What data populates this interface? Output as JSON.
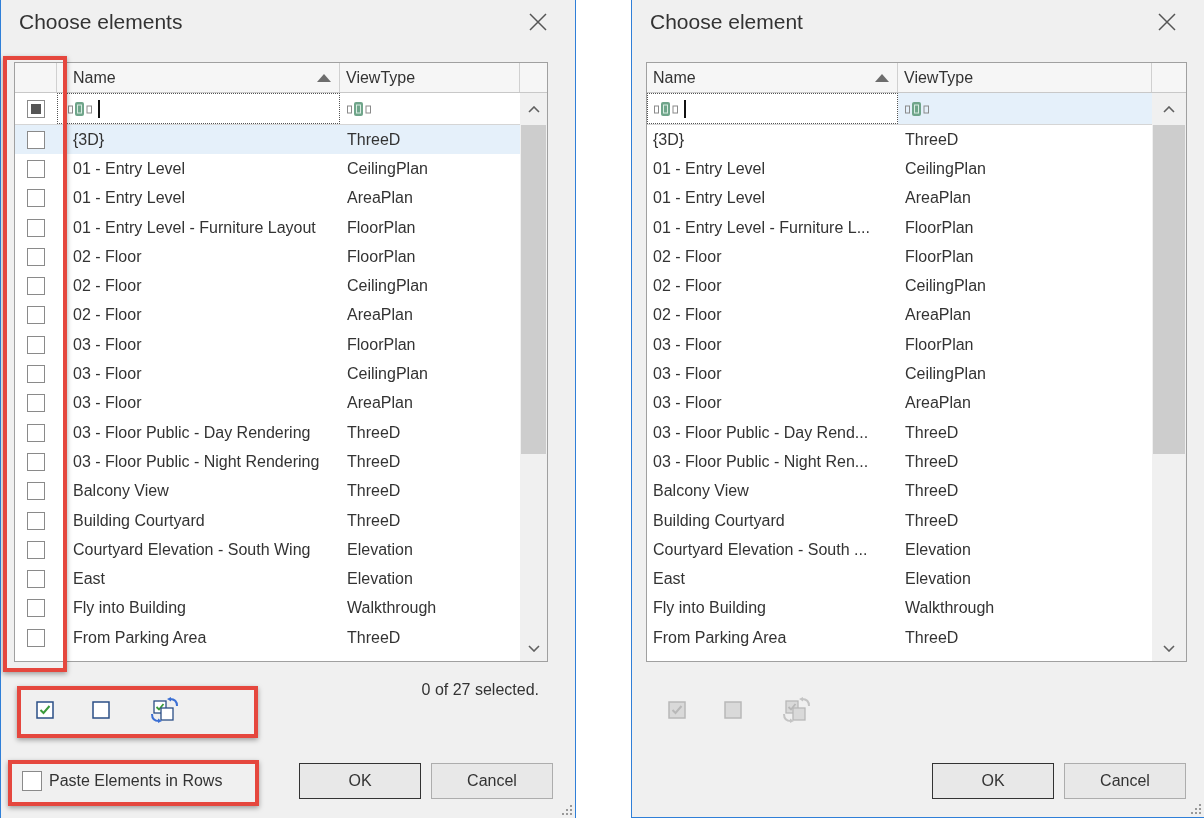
{
  "dialogs": [
    {
      "title": "Choose elements",
      "columns": [
        {
          "label": "Name",
          "sorted": true
        },
        {
          "label": "ViewType",
          "sorted": false
        }
      ],
      "check_column": {
        "select_all": {
          "checked": false,
          "indeterminate": true
        },
        "highlighted": true
      },
      "filters": [
        {
          "focused": true,
          "selected": false
        },
        {
          "focused": false,
          "selected": false
        }
      ],
      "rows": [
        {
          "name": "{3D}",
          "view_type": "ThreeD",
          "selected": true,
          "checked": false
        },
        {
          "name": "01 - Entry Level",
          "view_type": "CeilingPlan",
          "selected": false,
          "checked": false
        },
        {
          "name": "01 - Entry Level",
          "view_type": "AreaPlan",
          "selected": false,
          "checked": false
        },
        {
          "name": "01 - Entry Level - Furniture Layout",
          "view_type": "FloorPlan",
          "selected": false,
          "checked": false
        },
        {
          "name": "02 - Floor",
          "view_type": "FloorPlan",
          "selected": false,
          "checked": false
        },
        {
          "name": "02 - Floor",
          "view_type": "CeilingPlan",
          "selected": false,
          "checked": false
        },
        {
          "name": "02 - Floor",
          "view_type": "AreaPlan",
          "selected": false,
          "checked": false
        },
        {
          "name": "03 - Floor",
          "view_type": "FloorPlan",
          "selected": false,
          "checked": false
        },
        {
          "name": "03 - Floor",
          "view_type": "CeilingPlan",
          "selected": false,
          "checked": false
        },
        {
          "name": "03 - Floor",
          "view_type": "AreaPlan",
          "selected": false,
          "checked": false
        },
        {
          "name": "03 - Floor Public - Day Rendering",
          "view_type": "ThreeD",
          "selected": false,
          "checked": false
        },
        {
          "name": "03 - Floor Public - Night Rendering",
          "view_type": "ThreeD",
          "selected": false,
          "checked": false
        },
        {
          "name": "Balcony View",
          "view_type": "ThreeD",
          "selected": false,
          "checked": false
        },
        {
          "name": "Building Courtyard",
          "view_type": "ThreeD",
          "selected": false,
          "checked": false
        },
        {
          "name": "Courtyard Elevation - South Wing",
          "view_type": "Elevation",
          "selected": false,
          "checked": false
        },
        {
          "name": "East",
          "view_type": "Elevation",
          "selected": false,
          "checked": false
        },
        {
          "name": "Fly into Building",
          "view_type": "Walkthrough",
          "selected": false,
          "checked": false
        },
        {
          "name": "From Parking Area",
          "view_type": "ThreeD",
          "selected": false,
          "checked": false
        }
      ],
      "tools": {
        "disabled": false,
        "highlighted": true,
        "items": [
          {
            "kind": "check-all"
          },
          {
            "kind": "uncheck-all"
          },
          {
            "kind": "invert"
          }
        ]
      },
      "status": "0 of 27 selected.",
      "paste_option": {
        "label": "Paste Elements in Rows",
        "checked": false,
        "highlighted": true
      },
      "buttons": [
        {
          "label": "OK",
          "default": true
        },
        {
          "label": "Cancel",
          "default": false
        }
      ]
    },
    {
      "title": "Choose element",
      "columns": [
        {
          "label": "Name",
          "sorted": true
        },
        {
          "label": "ViewType",
          "sorted": false
        }
      ],
      "filters": [
        {
          "focused": true,
          "selected": false
        },
        {
          "focused": false,
          "selected": true
        }
      ],
      "rows": [
        {
          "name": "{3D}",
          "view_type": "ThreeD",
          "selected": false
        },
        {
          "name": "01 - Entry Level",
          "view_type": "CeilingPlan",
          "selected": false
        },
        {
          "name": "01 - Entry Level",
          "view_type": "AreaPlan",
          "selected": false
        },
        {
          "name": "01 - Entry Level - Furniture L...",
          "view_type": "FloorPlan",
          "selected": false
        },
        {
          "name": "02 - Floor",
          "view_type": "FloorPlan",
          "selected": false
        },
        {
          "name": "02 - Floor",
          "view_type": "CeilingPlan",
          "selected": false
        },
        {
          "name": "02 - Floor",
          "view_type": "AreaPlan",
          "selected": false
        },
        {
          "name": "03 - Floor",
          "view_type": "FloorPlan",
          "selected": false
        },
        {
          "name": "03 - Floor",
          "view_type": "CeilingPlan",
          "selected": false
        },
        {
          "name": "03 - Floor",
          "view_type": "AreaPlan",
          "selected": false
        },
        {
          "name": "03 - Floor Public - Day Rend...",
          "view_type": "ThreeD",
          "selected": false
        },
        {
          "name": "03 - Floor Public - Night Ren...",
          "view_type": "ThreeD",
          "selected": false
        },
        {
          "name": "Balcony View",
          "view_type": "ThreeD",
          "selected": false
        },
        {
          "name": "Building Courtyard",
          "view_type": "ThreeD",
          "selected": false
        },
        {
          "name": "Courtyard Elevation - South ...",
          "view_type": "Elevation",
          "selected": false
        },
        {
          "name": "East",
          "view_type": "Elevation",
          "selected": false
        },
        {
          "name": "Fly into Building",
          "view_type": "Walkthrough",
          "selected": false
        },
        {
          "name": "From Parking Area",
          "view_type": "ThreeD",
          "selected": false
        }
      ],
      "tools": {
        "disabled": true,
        "items": [
          {
            "kind": "check-all"
          },
          {
            "kind": "uncheck-all"
          },
          {
            "kind": "invert"
          }
        ]
      },
      "buttons": [
        {
          "label": "OK",
          "default": true
        },
        {
          "label": "Cancel",
          "default": false
        }
      ]
    }
  ]
}
